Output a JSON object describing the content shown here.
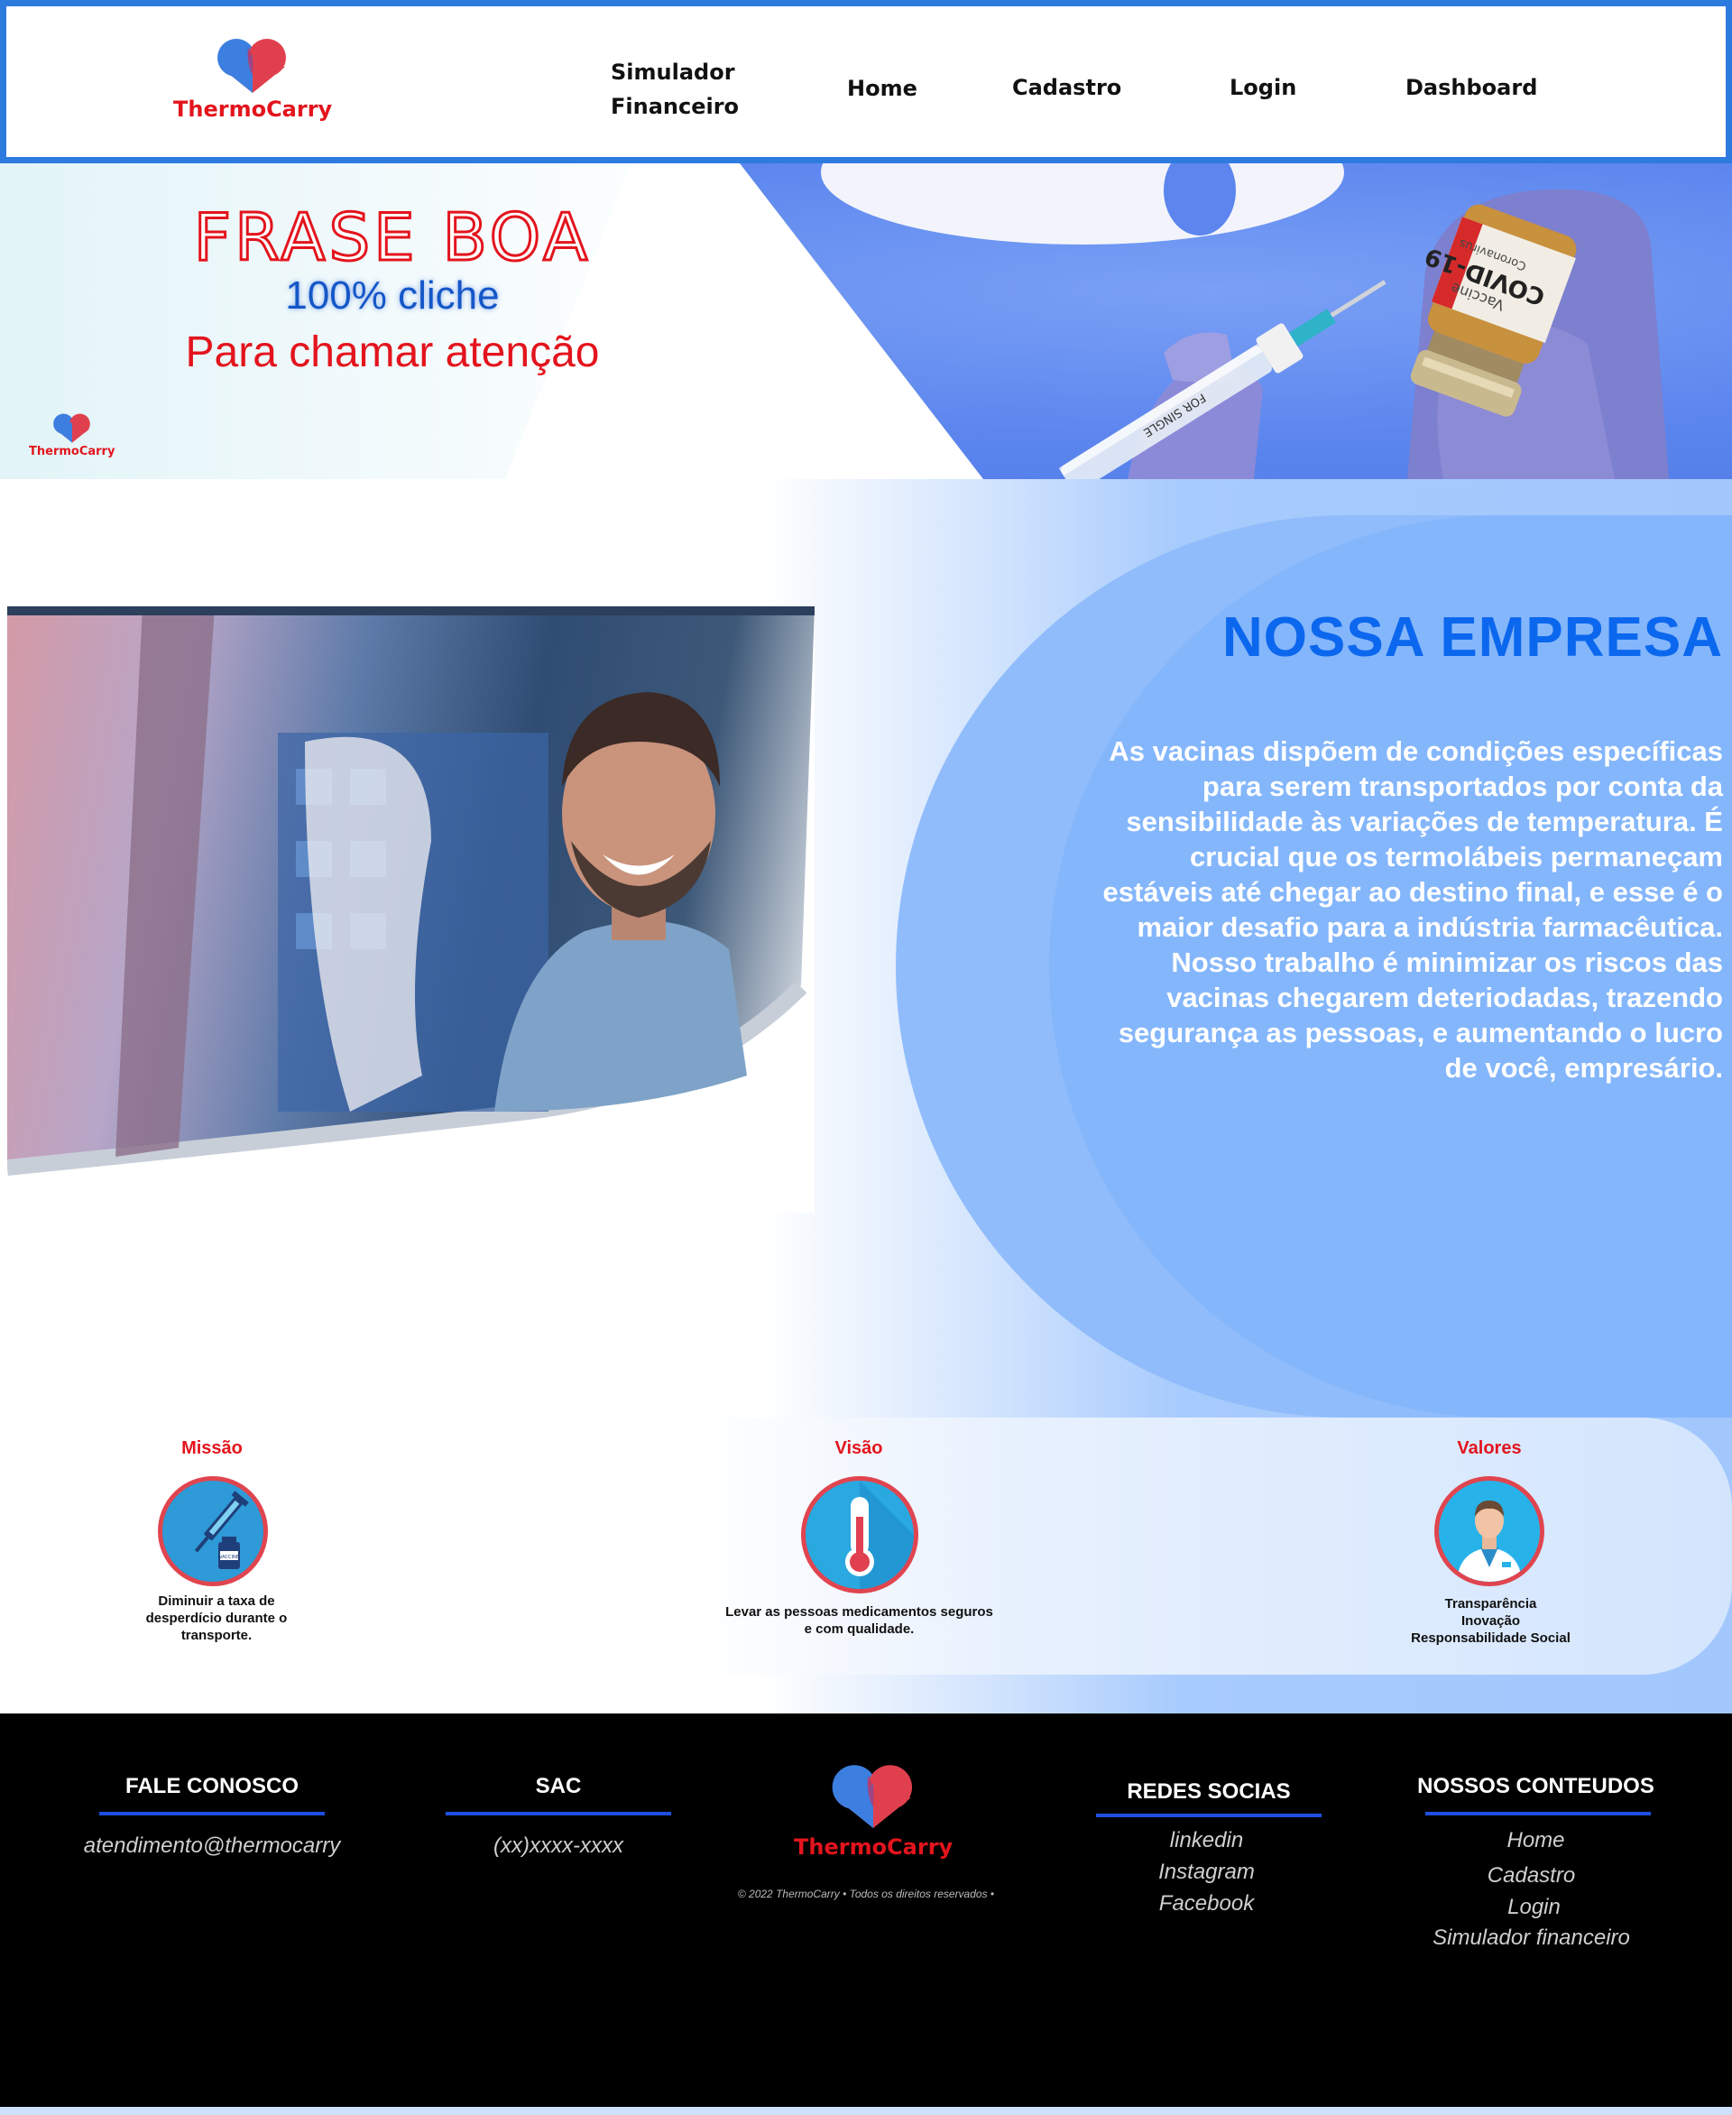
{
  "header": {
    "brand": "ThermoCarry",
    "nav": {
      "simulador_line1": "Simulador",
      "simulador_line2": "Financeiro",
      "home": "Home",
      "cadastro": "Cadastro",
      "login": "Login",
      "dashboard": "Dashboard"
    }
  },
  "hero": {
    "line1": "FRASE BOA",
    "line2": "100% cliche",
    "line3": "Para chamar atenção",
    "brand": "ThermoCarry",
    "vial_label_1": "COVID-19",
    "vial_label_2": "Coronavirus",
    "vial_label_3": "Vaccine",
    "syringe_label": "FOR SINGLE"
  },
  "about": {
    "title": "NOSSA EMPRESA",
    "text": "As vacinas dispõem de condições específicas para serem transportados por conta da sensibilidade às variações de temperatura. É crucial que os termolábeis permaneçam estáveis até chegar ao destino final, e esse é o maior desafio para a indústria farmacêutica. Nosso trabalho é minimizar os riscos das vacinas chegarem deteriodadas, trazendo segurança as pessoas, e aumentando o lucro de você, empresário."
  },
  "mvv": {
    "missao": {
      "title": "Missão",
      "text_1": "Diminuir a taxa de",
      "text_2": "desperdício durante o",
      "text_3": "transporte.",
      "vial_label": "VACCINE"
    },
    "visao": {
      "title": "Visão",
      "text_1": "Levar as pessoas medicamentos seguros",
      "text_2": "e com qualidade."
    },
    "valores": {
      "title": "Valores",
      "text_1": "Transparência",
      "text_2": "Inovação",
      "text_3": "Responsabilidade Social"
    }
  },
  "footer": {
    "fale_conosco": {
      "title": "FALE CONOSCO",
      "email": "atendimento@thermocarry"
    },
    "sac": {
      "title": "SAC",
      "phone": "(xx)xxxx-xxxx"
    },
    "brand": "ThermoCarry",
    "copyright": "© 2022 ThermoCarry • Todos os direitos reservados •",
    "redes": {
      "title": "REDES SOCIAS",
      "links": [
        "linkedin",
        "Instagram",
        "Facebook"
      ]
    },
    "conteudos": {
      "title": "NOSSOS CONTEUDOS",
      "links": [
        "Home",
        "Cadastro",
        "Login",
        "Simulador financeiro"
      ]
    }
  },
  "colors": {
    "accent_blue": "#2e7be0",
    "brand_red": "#e3141d",
    "title_blue": "#0b67ee",
    "footer_bg": "#000000",
    "footer_line": "#1f4fe0"
  },
  "icons": {
    "logo": "heart-logo-icon",
    "missao": "syringe-vaccine-icon",
    "visao": "thermometer-icon",
    "valores": "doctor-icon"
  }
}
